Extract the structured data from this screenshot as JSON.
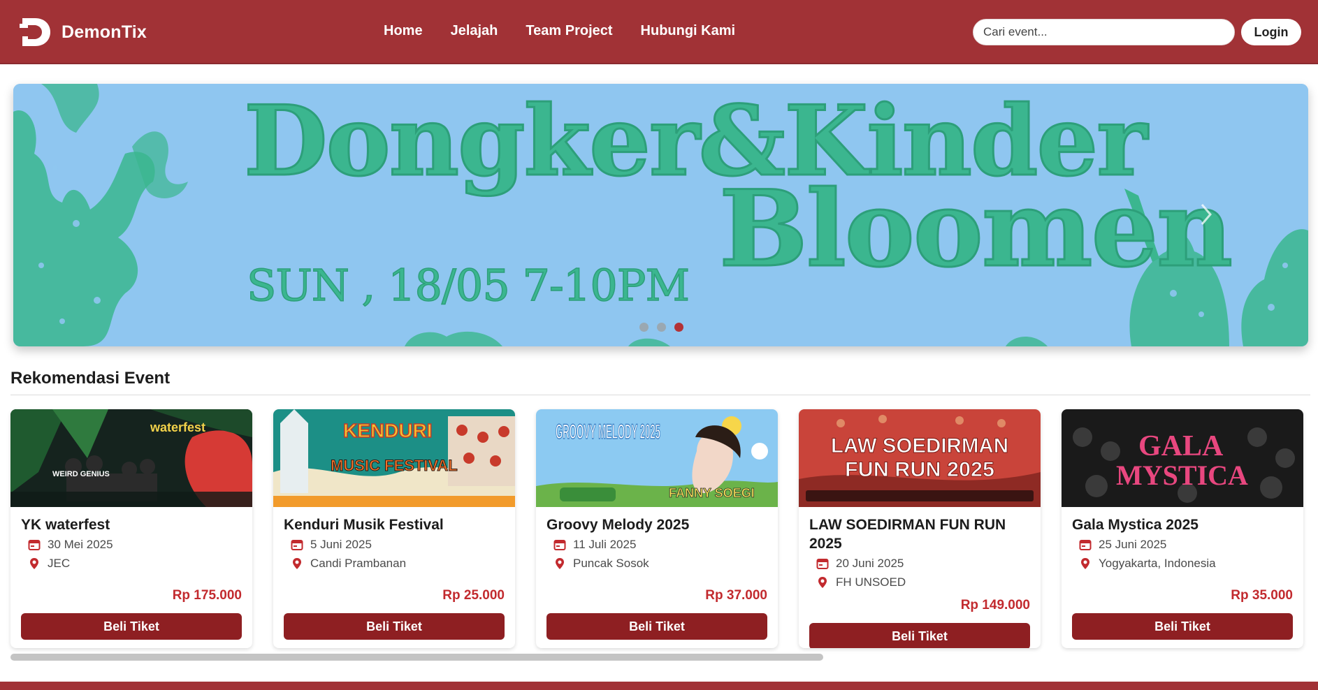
{
  "nav": {
    "brand": "DemonTix",
    "links": [
      "Home",
      "Jelajah",
      "Team Project",
      "Hubungi Kami"
    ],
    "search_placeholder": "Cari event...",
    "login_label": "Login"
  },
  "hero": {
    "title_line1": "Dongker&Kinder",
    "title_line2": "Bloomen",
    "date_text": "SUN , 18/05   7-10PM",
    "slide_count": 3,
    "active_slide": 3
  },
  "section": {
    "title": "Rekomendasi Event"
  },
  "events": [
    {
      "title": "YK waterfest",
      "date": "30 Mei 2025",
      "location": "JEC",
      "price": "Rp 175.000",
      "button": "Beli Tiket",
      "banner_text": "waterfest",
      "banner_label": "WEIRD GENIUS"
    },
    {
      "title": "Kenduri Musik Festival",
      "date": "5 Juni 2025",
      "location": "Candi Prambanan",
      "price": "Rp 25.000",
      "button": "Beli Tiket",
      "banner_text": "KENDURI",
      "banner_label": "MUSIC FESTIVAL"
    },
    {
      "title": "Groovy Melody 2025",
      "date": "11 Juli 2025",
      "location": "Puncak Sosok",
      "price": "Rp 37.000",
      "button": "Beli Tiket",
      "banner_text": "GROOVY MELODY 2025",
      "banner_label": "FANNY SOEGI"
    },
    {
      "title": "LAW SOEDIRMAN FUN RUN 2025",
      "date": "20 Juni 2025",
      "location": "FH UNSOED",
      "price": "Rp 149.000",
      "button": "Beli Tiket",
      "banner_text": "LAW SOEDIRMAN",
      "banner_label": "FUN RUN 2025"
    },
    {
      "title": "Gala Mystica 2025",
      "date": "25 Juni 2025",
      "location": "Yogyakarta, Indonesia",
      "price": "Rp 35.000",
      "button": "Beli Tiket",
      "banner_text": "GALA",
      "banner_label": "MYSTICA"
    }
  ],
  "scroll": {
    "visible_fraction": 0.625
  },
  "colors": {
    "brand": "#a13236",
    "button": "#8e1f22",
    "price": "#c22a2e",
    "hero_bg": "#8fc6f0",
    "hero_ink": "#3bb68f"
  },
  "icons": {
    "date": "calendar-icon",
    "location": "map-pin-icon",
    "next": "chevron-right-icon"
  }
}
